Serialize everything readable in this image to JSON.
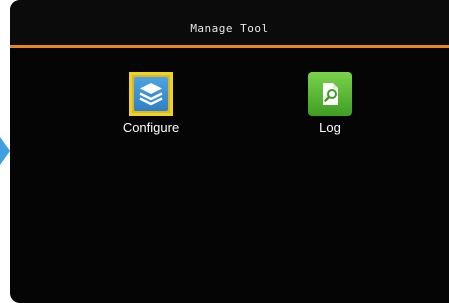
{
  "window": {
    "title": "Manage Tool"
  },
  "colors": {
    "background": "#050505",
    "header_divider": "#e4871f",
    "selection_border": "#f0d31f",
    "configure_icon": "#3b8fd6",
    "log_icon": "#4fb52f",
    "arrow": "#3f9fe0"
  },
  "menu": {
    "items": [
      {
        "label": "Configure",
        "icon": "layers-icon",
        "selected": true
      },
      {
        "label": "Log",
        "icon": "document-search-icon",
        "selected": false
      }
    ]
  }
}
